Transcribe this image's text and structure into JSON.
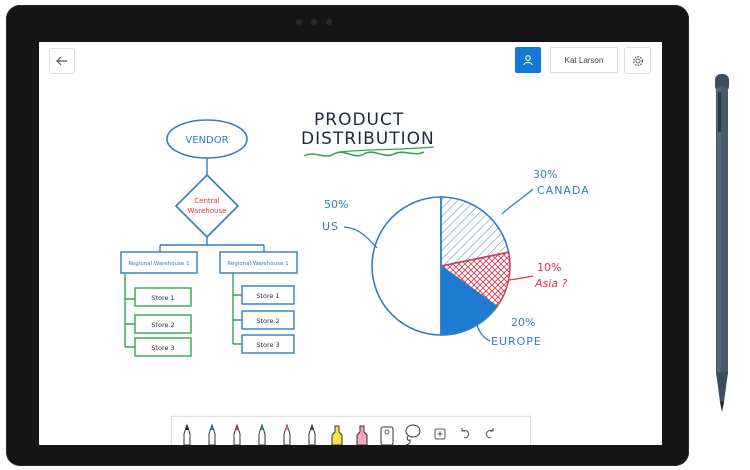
{
  "header": {
    "user_name": "Kat Larson"
  },
  "whiteboard": {
    "title_line1": "PRODUCT",
    "title_line2": "DISTRIBUTION",
    "flowchart": {
      "vendor": "VENDOR",
      "central_line1": "Central",
      "central_line2": "Warehouse",
      "regional_left": "Regional Warehouse 1",
      "regional_right": "Regional Warehouse 1",
      "stores_left": [
        "Store 1",
        "Store 2",
        "Store 3"
      ],
      "stores_right": [
        "Store 1",
        "Store 2",
        "Store 3"
      ]
    },
    "pie_labels": {
      "us_percent": "50%",
      "us": "US",
      "canada_percent": "30%",
      "canada": "CANADA",
      "asia_percent": "10%",
      "asia": "Asia ?",
      "europe_percent": "20%",
      "europe": "EUROPE"
    }
  },
  "colors": {
    "ink_blue": "#2e7ec6",
    "ink_red": "#e0324a",
    "ink_green": "#31a84f",
    "ink_dark": "#1e2a3a",
    "accent": "#1478d4"
  },
  "toolbar": {
    "tools": [
      "pen-black",
      "pen-blue",
      "pen-red",
      "pen-green",
      "pen-pink",
      "pen-navy",
      "highlighter-yellow",
      "highlighter-pink",
      "eraser",
      "lasso",
      "add",
      "undo",
      "redo"
    ]
  }
}
